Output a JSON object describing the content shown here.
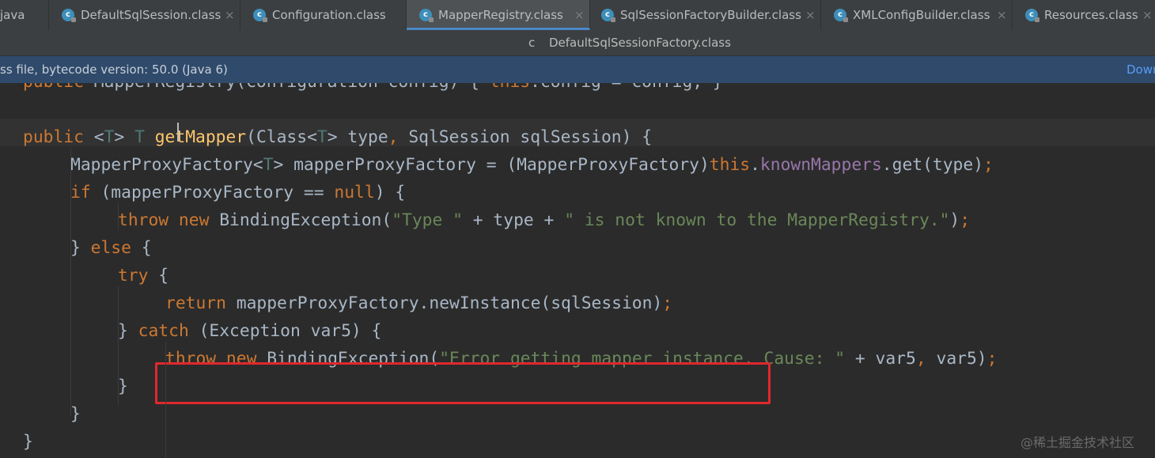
{
  "tabs_row1": [
    {
      "label": "java",
      "has_icon": false,
      "active": false
    },
    {
      "label": "DefaultSqlSession.class",
      "has_icon": true,
      "active": false
    },
    {
      "label": "Configuration.class",
      "has_icon": true,
      "active": false
    },
    {
      "label": "MapperRegistry.class",
      "has_icon": true,
      "active": true
    },
    {
      "label": "SqlSessionFactoryBuilder.class",
      "has_icon": true,
      "active": false
    },
    {
      "label": "XMLConfigBuilder.class",
      "has_icon": true,
      "active": false
    },
    {
      "label": "Resources.class",
      "has_icon": true,
      "active": false
    }
  ],
  "tab_row2": {
    "label": "DefaultSqlSessionFactory.class"
  },
  "tab_close_glyph": "×",
  "tab_icon_letter": "c",
  "banner": {
    "text": "ss file, bytecode version: 50.0 (Java 6)",
    "link": "Down"
  },
  "code_lines": [
    {
      "indent": 0,
      "tokens": [
        {
          "t": "public",
          "c": "kw"
        },
        {
          "t": " ",
          "c": ""
        },
        {
          "t": "MapperRegistry",
          "c": ""
        },
        {
          "t": "(Configuration config) { ",
          "c": ""
        },
        {
          "t": "this",
          "c": "kw"
        },
        {
          "t": ".config = config; }",
          "c": ""
        }
      ]
    },
    {
      "indent": 0,
      "tokens": []
    },
    {
      "indent": 0,
      "tokens": [
        {
          "t": "public",
          "c": "kw"
        },
        {
          "t": " <",
          "c": ""
        },
        {
          "t": "T",
          "c": "tp"
        },
        {
          "t": "> ",
          "c": ""
        },
        {
          "t": "T",
          "c": "tp"
        },
        {
          "t": " ",
          "c": ""
        },
        {
          "t": "getMapper",
          "c": "fn"
        },
        {
          "t": "(Class<",
          "c": ""
        },
        {
          "t": "T",
          "c": "tp"
        },
        {
          "t": "> type",
          "c": ""
        },
        {
          "t": ", ",
          "c": "kw"
        },
        {
          "t": "SqlSession sqlSession) {",
          "c": ""
        }
      ]
    },
    {
      "indent": 1,
      "tokens": [
        {
          "t": "MapperProxyFactory<",
          "c": ""
        },
        {
          "t": "T",
          "c": "tp"
        },
        {
          "t": "> mapperProxyFactory = (MapperProxyFactory)",
          "c": ""
        },
        {
          "t": "this",
          "c": "kw"
        },
        {
          "t": ".",
          "c": ""
        },
        {
          "t": "knownMappers",
          "c": "fld"
        },
        {
          "t": ".get(type)",
          "c": ""
        },
        {
          "t": ";",
          "c": "kw"
        }
      ]
    },
    {
      "indent": 1,
      "tokens": [
        {
          "t": "if",
          "c": "kw"
        },
        {
          "t": " (mapperProxyFactory == ",
          "c": ""
        },
        {
          "t": "null",
          "c": "kw"
        },
        {
          "t": ") {",
          "c": ""
        }
      ]
    },
    {
      "indent": 2,
      "tokens": [
        {
          "t": "throw new",
          "c": "kw"
        },
        {
          "t": " BindingException(",
          "c": ""
        },
        {
          "t": "\"Type \"",
          "c": "str"
        },
        {
          "t": " + type + ",
          "c": ""
        },
        {
          "t": "\" is not known to the MapperRegistry.\"",
          "c": "str"
        },
        {
          "t": ")",
          "c": ""
        },
        {
          "t": ";",
          "c": "kw"
        }
      ]
    },
    {
      "indent": 1,
      "tokens": [
        {
          "t": "} ",
          "c": ""
        },
        {
          "t": "else",
          "c": "kw"
        },
        {
          "t": " {",
          "c": ""
        }
      ]
    },
    {
      "indent": 2,
      "tokens": [
        {
          "t": "try",
          "c": "kw"
        },
        {
          "t": " {",
          "c": ""
        }
      ]
    },
    {
      "indent": 3,
      "tokens": [
        {
          "t": "return",
          "c": "kw"
        },
        {
          "t": " mapperProxyFactory.newInstance(sqlSession)",
          "c": ""
        },
        {
          "t": ";",
          "c": "kw"
        }
      ]
    },
    {
      "indent": 2,
      "tokens": [
        {
          "t": "} ",
          "c": ""
        },
        {
          "t": "catch",
          "c": "kw"
        },
        {
          "t": " (Exception var5) {",
          "c": ""
        }
      ]
    },
    {
      "indent": 3,
      "tokens": [
        {
          "t": "throw new",
          "c": "kw"
        },
        {
          "t": " BindingException(",
          "c": ""
        },
        {
          "t": "\"Error getting mapper instance. Cause: \"",
          "c": "str"
        },
        {
          "t": " + var5",
          "c": ""
        },
        {
          "t": ", ",
          "c": "kw"
        },
        {
          "t": "var5)",
          "c": ""
        },
        {
          "t": ";",
          "c": "kw"
        }
      ]
    },
    {
      "indent": 2,
      "tokens": [
        {
          "t": "}",
          "c": ""
        }
      ]
    },
    {
      "indent": 1,
      "tokens": [
        {
          "t": "}",
          "c": ""
        }
      ]
    },
    {
      "indent": 0,
      "tokens": [
        {
          "t": "}",
          "c": ""
        }
      ]
    }
  ],
  "watermark": "@稀土掘金技术社区",
  "colors": {
    "keyword": "#cc7832",
    "string": "#6a8759",
    "field": "#9876aa",
    "method_decl": "#ffc66d",
    "type_param": "#507874",
    "default_text": "#a9b7c6",
    "editor_bg": "#2b2b2b",
    "highlight_box": "#e0282d",
    "active_tab_underline": "#4a88c7",
    "banner_bg": "#2f4a6b"
  }
}
